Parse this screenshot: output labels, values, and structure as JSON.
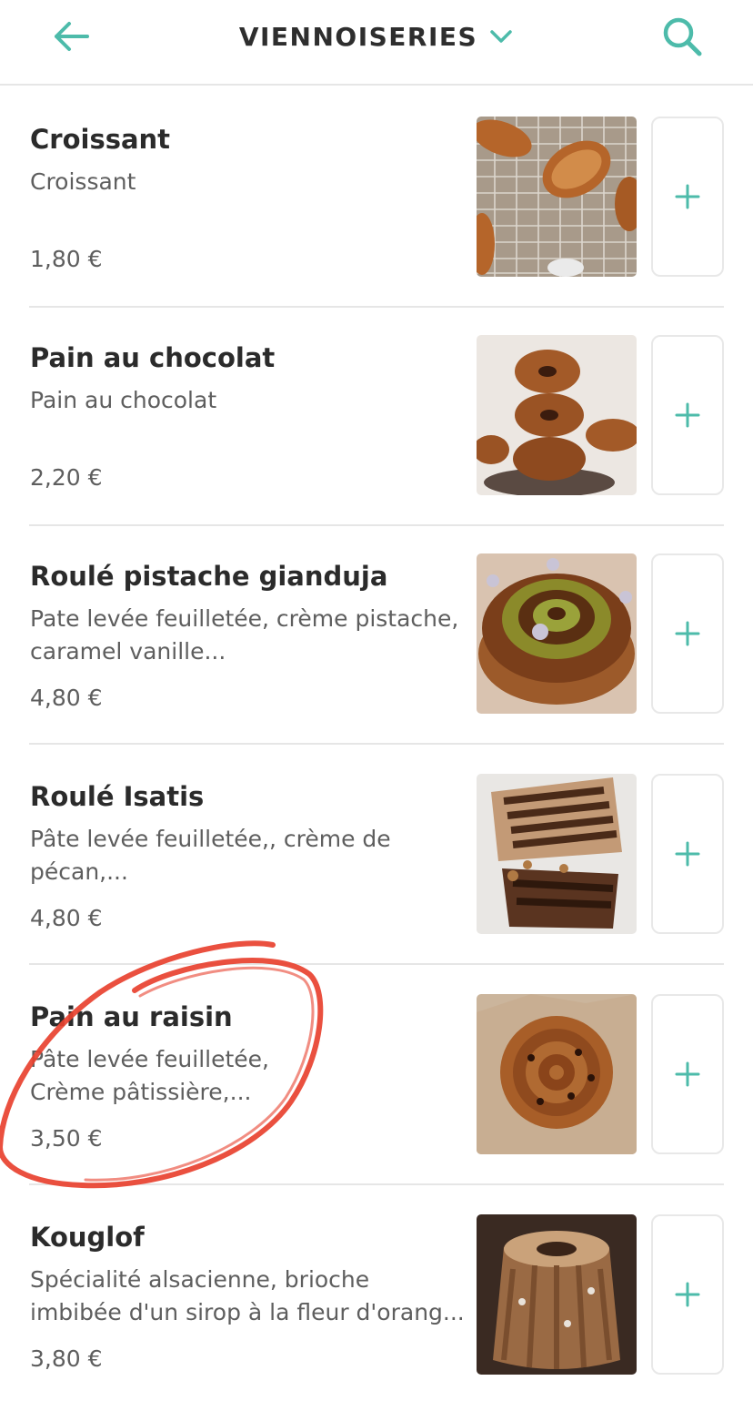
{
  "header": {
    "back_icon": "arrow-left-icon",
    "title": "VIENNOISERIES",
    "dropdown_icon": "chevron-down-icon",
    "search_icon": "search-icon",
    "accent_color": "#4dbbaa"
  },
  "items": [
    {
      "name": "Croissant",
      "description": "Croissant",
      "price": "1,80 €",
      "add_icon": "plus-icon"
    },
    {
      "name": "Pain au chocolat",
      "description": "Pain au chocolat",
      "price": "2,20 €",
      "add_icon": "plus-icon"
    },
    {
      "name": "Roulé pistache gianduja",
      "description": "Pate levée feuilletée, crème pistache, caramel vanille...",
      "price": "4,80 €",
      "add_icon": "plus-icon"
    },
    {
      "name": "Roulé Isatis",
      "description": "Pâte levée feuilletée,, crème de pécan,...",
      "price": "4,80 €",
      "add_icon": "plus-icon"
    },
    {
      "name": "Pain au raisin",
      "description": "Pâte levée feuilletée, Crème pâtissière,...",
      "price": "3,50 €",
      "add_icon": "plus-icon"
    },
    {
      "name": "Kouglof",
      "description": "Spécialité alsacienne, brioche imbibée d'un sirop à la fleur d'orang...",
      "price": "3,80 €",
      "add_icon": "plus-icon"
    }
  ],
  "annotation": {
    "color": "#e8412f"
  }
}
